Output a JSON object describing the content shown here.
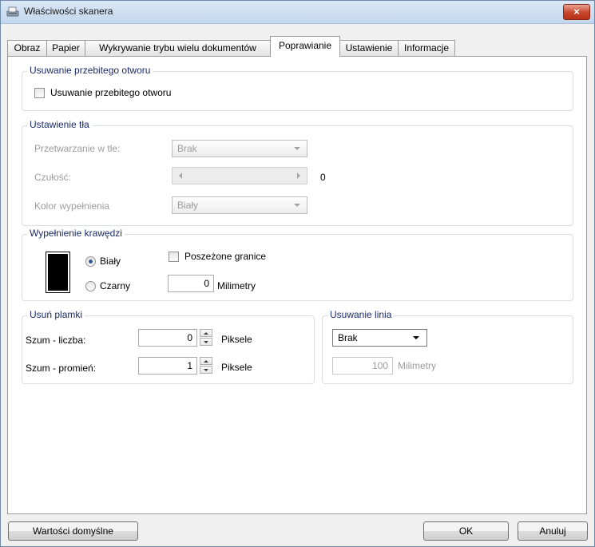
{
  "window": {
    "title": "Właściwości skanera",
    "close_label": "×"
  },
  "tabs": [
    {
      "label": "Obraz"
    },
    {
      "label": "Papier"
    },
    {
      "label": "Wykrywanie trybu wielu dokumentów"
    },
    {
      "label": "Poprawianie",
      "active": true
    },
    {
      "label": "Ustawienie"
    },
    {
      "label": "Informacje"
    }
  ],
  "hole_removal": {
    "group_label": "Usuwanie przebitego otworu",
    "checkbox_label": "Usuwanie przebitego otworu",
    "checked": false
  },
  "background": {
    "group_label": "Ustawienie tła",
    "processing_label": "Przetwarzanie w tle:",
    "processing_value": "Brak",
    "sensitivity_label": "Czułość:",
    "sensitivity_value": "0",
    "fill_color_label": "Kolor wypełnienia",
    "fill_color_value": "Biały"
  },
  "edge_fill": {
    "group_label": "Wypełnienie krawędzi",
    "white_label": "Biały",
    "black_label": "Czarny",
    "selected": "Biały",
    "extended_label": "Poszeżone granice",
    "extended_checked": false,
    "value": "0",
    "unit": "Milimetry"
  },
  "speckle": {
    "group_label": "Usuń plamki",
    "noise_count_label": "Szum - liczba:",
    "noise_count_value": "0",
    "noise_count_unit": "Piksele",
    "noise_radius_label": "Szum - promień:",
    "noise_radius_value": "1",
    "noise_radius_unit": "Piksele"
  },
  "line_removal": {
    "group_label": "Usuwanie linia",
    "mode_value": "Brak",
    "length_value": "100",
    "length_unit": "Milimetry"
  },
  "footer": {
    "defaults_label": "Wartości domyślne",
    "ok_label": "OK",
    "cancel_label": "Anuluj"
  }
}
